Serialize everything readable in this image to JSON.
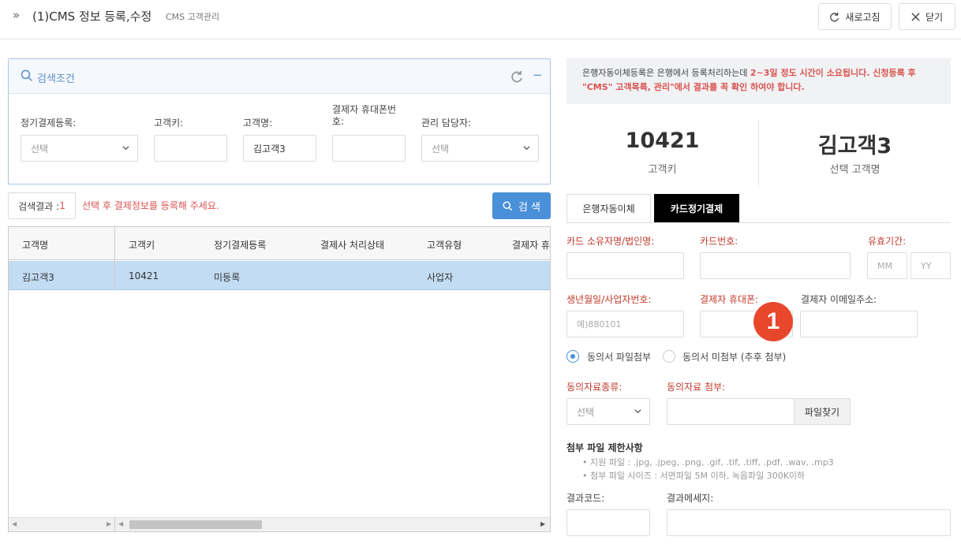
{
  "header": {
    "title": "(1)CMS 정보 등록,수정",
    "subtitle": "CMS 고객관리",
    "refresh_label": "새로고침",
    "close_label": "닫기"
  },
  "search": {
    "title": "검색조건",
    "collapse": "−",
    "fields": {
      "regular_payment_label": "정기결제등록:",
      "regular_payment_value": "선택",
      "customer_key_label": "고객키:",
      "customer_key_value": "",
      "customer_name_label": "고객명:",
      "customer_name_value": "김고객3",
      "payer_phone_label_1": "결제자 휴대폰번",
      "payer_phone_label_2": "호:",
      "payer_phone_value": "",
      "manager_label": "관리 담당자:",
      "manager_value": "선택"
    },
    "result_label": "검색결과 : ",
    "result_count": "1",
    "hint": "선택 후 결제정보를 등록해 주세요.",
    "search_button": "검 색"
  },
  "grid": {
    "columns": [
      "고객명",
      "고객키",
      "정기결제등록",
      "결제사 처리상태",
      "고객유형",
      "결제자 휴"
    ],
    "rows": [
      [
        "김고객3",
        "10421",
        "미등록",
        "",
        "사업자",
        ""
      ]
    ]
  },
  "notice": {
    "part1": "은행자동이체등록은 은행에서 등록처리하는데 ",
    "part2": "2~3일 정도 시간이 소요됩니다. 신청등록 후 \"CMS\" 고객목록, 관리\"에서 결과를 꼭 확인 하여야 합니다."
  },
  "stats": {
    "customer_key": "10421",
    "customer_key_label": "고객키",
    "customer_name": "김고객3",
    "customer_name_label": "선택 고객명"
  },
  "tabs": [
    "은행자동이체",
    "카드정기결제"
  ],
  "card_form": {
    "owner_label": "카드 소유자명/법인명:",
    "card_number_label": "카드번호:",
    "expiry_label": "유효기간:",
    "mm_placeholder": "MM",
    "yy_placeholder": "YY",
    "birth_label": "생년월일/사업자번호:",
    "birth_placeholder": "예)880101",
    "payer_phone_label": "결제자 휴대폰:",
    "payer_email_label": "결제자 이메일주소:",
    "consent_attach": "동의서 파일첨부",
    "consent_later": "동의서 미첨부 (추후 첨부)",
    "consent_type_label": "동의자료종류:",
    "consent_type_value": "선택",
    "consent_file_label": "동의자료 첨부:",
    "file_button": "파일찾기",
    "restrict_title": "첨부 파일 제한사항",
    "restrict_items": [
      "지원 파일 : .jpg, .jpeg, .png, .gif, .tif, .tiff, .pdf, .wav, .mp3",
      "첨부 파일 사이즈 : 서면파일 5M 이하, 녹음파일 300K이하"
    ],
    "result_code_label": "결과코드:",
    "result_message_label": "결과메세지:"
  },
  "badge": "1",
  "colors": {
    "accent": "#4a90d9",
    "danger": "#d9534f",
    "selected_row": "#c2dcf3",
    "badge": "#e8472c"
  }
}
